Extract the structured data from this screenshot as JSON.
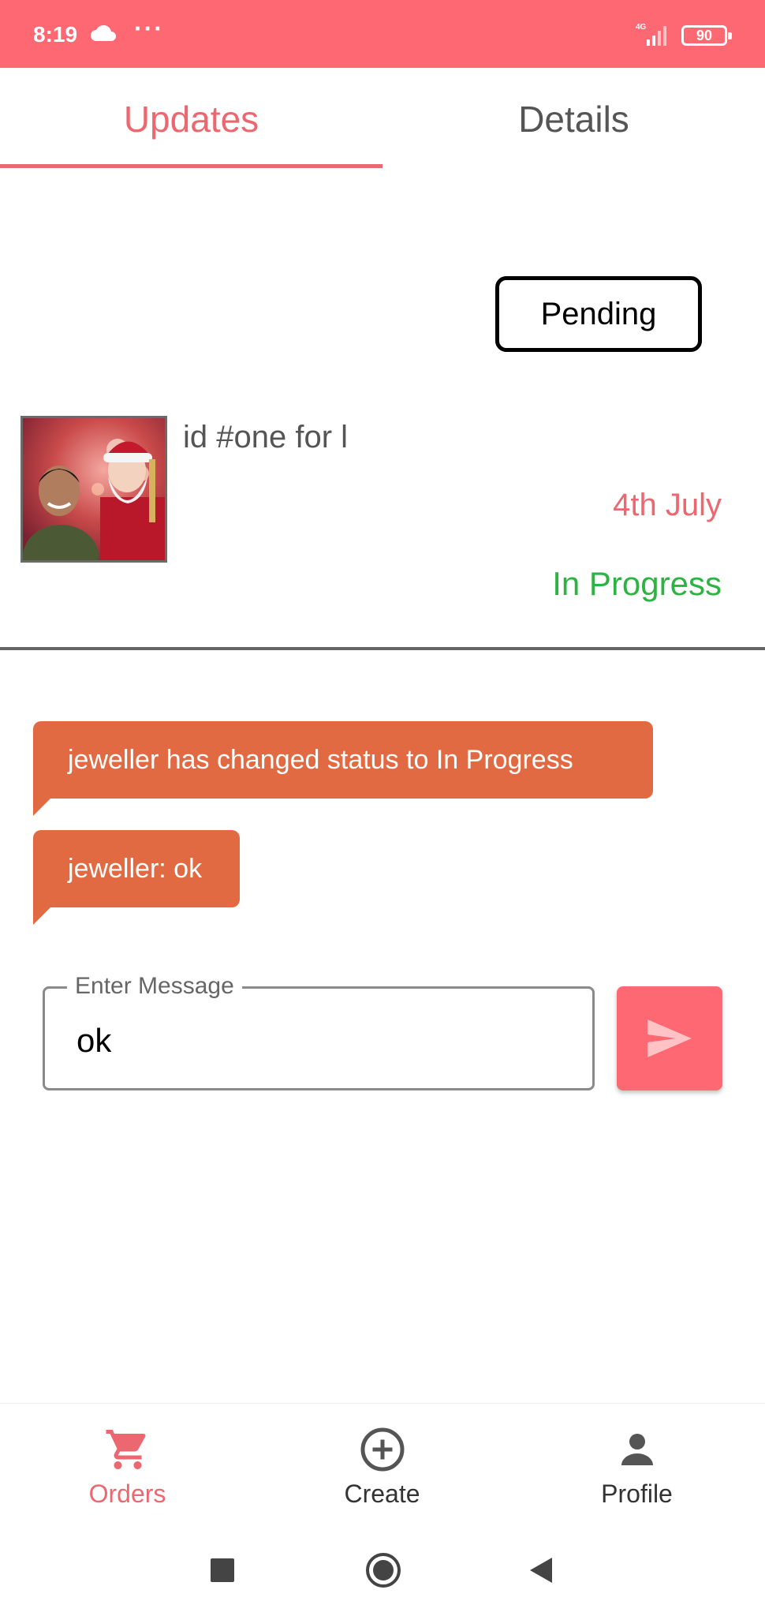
{
  "status_bar": {
    "time": "8:19",
    "dots": "···",
    "battery": "90",
    "network": "4G",
    "icons": [
      "cloud-icon",
      "signal-icon",
      "battery-icon"
    ]
  },
  "tabs": [
    {
      "label": "Updates",
      "active": true
    },
    {
      "label": "Details",
      "active": false
    }
  ],
  "order": {
    "status_button": "Pending",
    "title": "id #one for l",
    "date": "4th July",
    "progress_status": "In Progress"
  },
  "messages": [
    {
      "text": "jeweller has changed status to In Progress"
    },
    {
      "text": "jeweller: ok"
    }
  ],
  "composer": {
    "label": "Enter Message",
    "value": "ok",
    "send_icon": "send-icon"
  },
  "bottom_nav": [
    {
      "label": "Orders",
      "icon": "cart-icon",
      "active": true
    },
    {
      "label": "Create",
      "icon": "add-circle-icon",
      "active": false
    },
    {
      "label": "Profile",
      "icon": "person-icon",
      "active": false
    }
  ],
  "colors": {
    "accent": "#fd6872",
    "tab_active": "#ec6870",
    "message_bubble": "#e16a42",
    "status_green": "#2cb341"
  }
}
